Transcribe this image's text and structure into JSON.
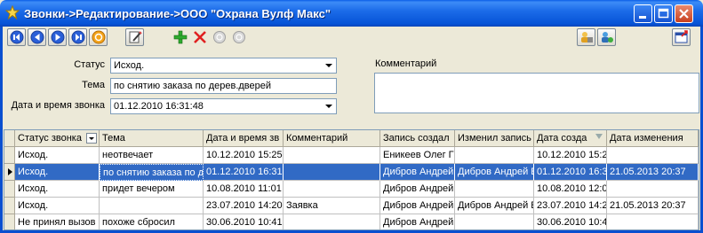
{
  "window": {
    "title": "Звонки->Редактирование->ООО \"Охрана Вулф Макс\""
  },
  "toolbar": {
    "buttons": [
      "first-icon",
      "prev-icon",
      "next-icon",
      "last-icon",
      "refresh-icon",
      "edit-icon",
      "add-icon",
      "delete-icon",
      "save-icon",
      "cancel-icon",
      "users-icon",
      "settings-icon",
      "exit-icon"
    ]
  },
  "form": {
    "status_label": "Статус",
    "status_value": "Исход.",
    "topic_label": "Тема",
    "topic_value": "по снятию заказа по дерев.дверей",
    "datetime_label": "Дата и время звонка",
    "datetime_value": "01.12.2010 16:31:48",
    "comment_label": "Комментарий",
    "comment_value": ""
  },
  "grid": {
    "columns": [
      "Статус звонка",
      "Тема",
      "Дата и время зв",
      "Комментарий",
      "Запись создал",
      "Изменил запись",
      "Дата созда",
      "Дата изменения"
    ],
    "rows": [
      [
        "Исход.",
        "неотвечает",
        "10.12.2010 15:25",
        "",
        "Еникеев Олег Г",
        "",
        "10.12.2010 15:2",
        ""
      ],
      [
        "Исход.",
        "по снятию заказа по д",
        "01.12.2010 16:31",
        "",
        "Дибров Андрей",
        "Дибров Андрей Е",
        "01.12.2010 16:3",
        "21.05.2013 20:37"
      ],
      [
        "Исход.",
        "придет вечером",
        "10.08.2010 11:01",
        "",
        "Дибров Андрей",
        "",
        "10.08.2010 12:0",
        ""
      ],
      [
        "Исход.",
        "",
        "23.07.2010 14:20",
        "Заявка",
        "Дибров Андрей",
        "Дибров Андрей Е",
        "23.07.2010 14:2",
        "21.05.2013 20:37"
      ],
      [
        "Не принял вызов",
        "похоже сбросил",
        "30.06.2010 10:41",
        "",
        "Дибров Андрей",
        "",
        "30.06.2010 10:4",
        ""
      ]
    ],
    "selected_row": 1
  }
}
